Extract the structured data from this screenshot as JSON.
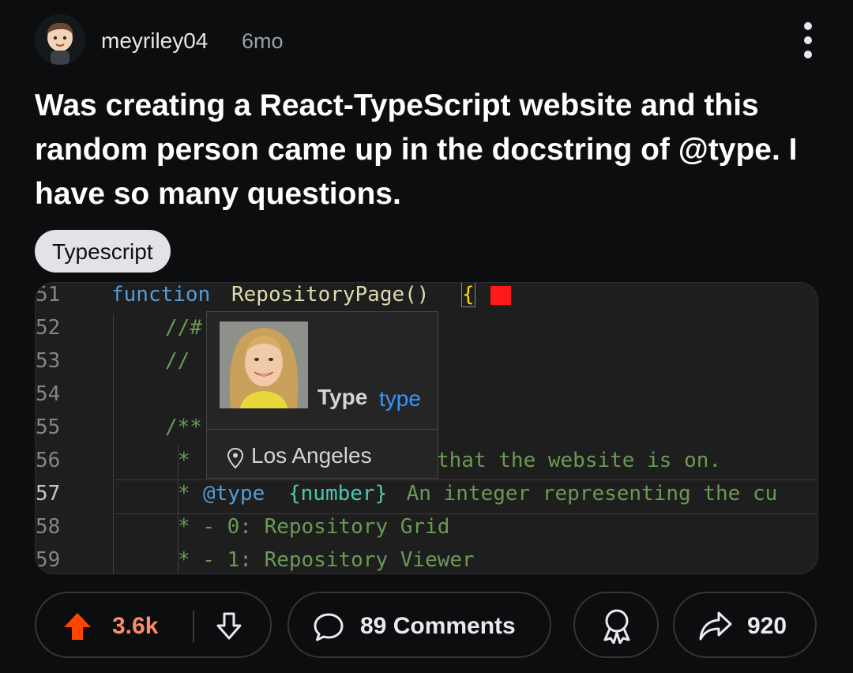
{
  "post": {
    "username": "meyriley04",
    "age": "6mo",
    "title": "Was creating a React-TypeScript website and this random person came up in the docstring of @type. I have so many questions.",
    "flair": "Typescript"
  },
  "code": {
    "line_numbers": [
      "51",
      "52",
      "53",
      "54",
      "55",
      "56",
      "57",
      "58",
      "59"
    ],
    "line_51": {
      "keyword": "function",
      "name": "RepositoryPage()",
      "brace": "{"
    },
    "line_52": "//#",
    "line_53": "//",
    "line_55": "/**",
    "line_56_star": "*",
    "line_56_text": "that the website is on.",
    "line_57_star": "*",
    "line_57_tag": "@type",
    "line_57_type": "{number}",
    "line_57_text": " An integer representing the cu",
    "line_58": "* - 0: Repository Grid",
    "line_59": "* - 1: Repository Viewer"
  },
  "hover_card": {
    "type_word": "Type",
    "type_kw": "type",
    "location": "Los Angeles"
  },
  "actions": {
    "score": "3.6k",
    "comments": "89 Comments",
    "shares": "920"
  },
  "colors": {
    "background": "#0b0d0f",
    "upvote_active": "#ff4500",
    "score": "#ff8a65"
  },
  "icons": [
    "more-vertical-icon",
    "upvote-arrow-icon",
    "downvote-arrow-icon",
    "comment-bubble-icon",
    "award-icon",
    "share-arrow-icon",
    "location-pin-icon"
  ]
}
